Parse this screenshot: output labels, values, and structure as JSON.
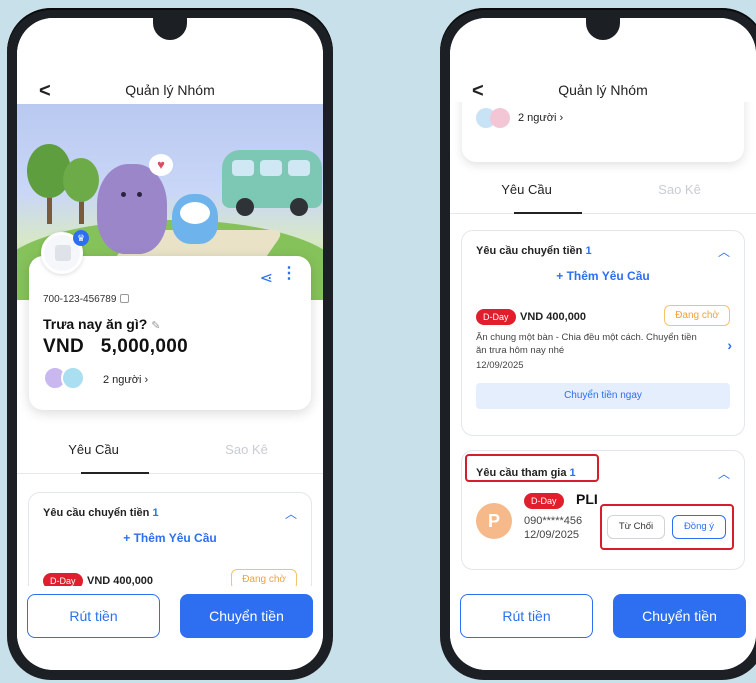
{
  "left": {
    "header": {
      "title": "Quản lý Nhóm",
      "back": "<"
    },
    "card": {
      "account": "700-123-456789",
      "group_name": "Trưa nay ăn gì?",
      "balance": "VND   5,000,000",
      "members": "2 người"
    },
    "tabs": [
      "Yêu Cầu",
      "Sao Kê"
    ],
    "transfer_section": {
      "title": "Yêu cầu chuyển tiền",
      "count": "1",
      "add": "+ Thêm Yêu Cầu",
      "item": {
        "tag": "D-Day",
        "amount": "VND 400,000",
        "status": "Đang chờ"
      }
    },
    "bottom": {
      "withdraw": "Rút tiền",
      "transfer": "Chuyển tiền"
    }
  },
  "right": {
    "header": {
      "title": "Quản lý Nhóm",
      "back": "<"
    },
    "card": {
      "members": "2 người"
    },
    "tabs": [
      "Yêu Cầu",
      "Sao Kê"
    ],
    "transfer_section": {
      "title": "Yêu cầu chuyển tiền",
      "count": "1",
      "add": "+ Thêm Yêu Cầu",
      "item": {
        "tag": "D-Day",
        "amount": "VND 400,000",
        "status": "Đang chờ",
        "desc": "Ăn chung một bàn - Chia đều một cách. Chuyển tiền ăn trưa hôm nay nhé",
        "date": "12/09/2025",
        "action": "Chuyển tiền ngay"
      }
    },
    "join_section": {
      "title": "Yêu cầu tham gia",
      "count": "1",
      "user": {
        "avatar_letter": "P",
        "tag": "D-Day",
        "name": "PLI",
        "phone": "090*****456",
        "date": "12/09/2025"
      },
      "reject": "Từ Chối",
      "accept": "Đồng ý"
    },
    "bottom": {
      "withdraw": "Rút tiền",
      "transfer": "Chuyển tiền"
    }
  },
  "colors": {
    "primary": "#2d6ff0",
    "danger": "#e01e2c",
    "pending": "#f0a23a"
  }
}
